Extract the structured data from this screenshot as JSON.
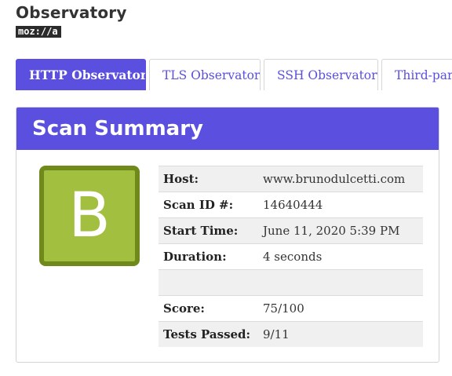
{
  "header": {
    "title": "Observatory",
    "logo_text": "moz://a"
  },
  "tabs": [
    {
      "label": "HTTP Observatory",
      "active": true
    },
    {
      "label": "TLS Observatory",
      "active": false
    },
    {
      "label": "SSH Observatory",
      "active": false
    },
    {
      "label": "Third-party",
      "active": false
    }
  ],
  "summary": {
    "title": "Scan Summary",
    "grade": "B",
    "rows": [
      {
        "label": "Host:",
        "value": "www.brunodulcetti.com"
      },
      {
        "label": "Scan ID #:",
        "value": "14640444"
      },
      {
        "label": "Start Time:",
        "value": "June 11, 2020 5:39 PM"
      },
      {
        "label": "Duration:",
        "value": "4 seconds"
      },
      {
        "label": "",
        "value": ""
      },
      {
        "label": "Score:",
        "value": "75/100"
      },
      {
        "label": "Tests Passed:",
        "value": "9/11"
      }
    ]
  },
  "colors": {
    "accent": "#5a4fde",
    "grade_fill": "#a3bf3f",
    "grade_border": "#6f8a1a"
  }
}
